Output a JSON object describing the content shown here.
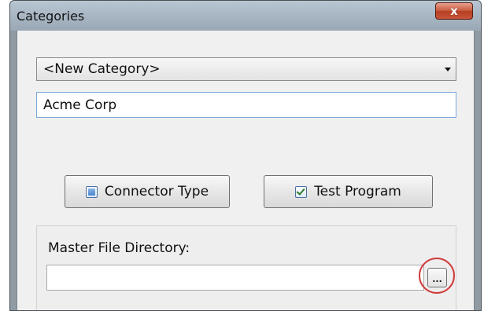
{
  "window": {
    "title": "Categories",
    "close_label": "x"
  },
  "category": {
    "selected": "<New Category>"
  },
  "name_field": {
    "value": "Acme Corp"
  },
  "buttons": {
    "connector_type": "Connector Type",
    "test_program": "Test Program",
    "browse": "..."
  },
  "master_file_directory": {
    "label": "Master File Directory:",
    "value": ""
  },
  "state": {
    "connector_type_checked": false,
    "test_program_checked": true
  },
  "icons": {
    "close": "close-icon",
    "combo_arrow": "chevron-down-icon",
    "connector_checkbox": "checkbox-unchecked-icon",
    "test_checkbox": "checkbox-checked-icon"
  },
  "colors": {
    "highlight": "#d03b3b",
    "close_button": "#c8533a",
    "input_focus_border": "#7aa7d6"
  }
}
